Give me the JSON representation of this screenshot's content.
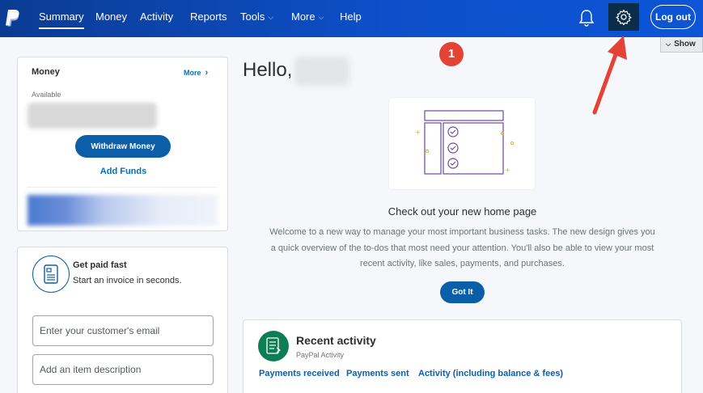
{
  "nav": {
    "items": [
      {
        "label": "Summary"
      },
      {
        "label": "Money"
      },
      {
        "label": "Activity"
      },
      {
        "label": "Reports"
      },
      {
        "label": "Tools"
      },
      {
        "label": "More"
      },
      {
        "label": "Help"
      }
    ],
    "logout_label": "Log out",
    "icons": {
      "logo": "paypal-logo-icon",
      "bell": "bell-icon",
      "gear": "gear-icon"
    },
    "gradient_colors": [
      "#0b3c93",
      "#0d55d6"
    ],
    "settings_highlight_color": "#0a2d4a"
  },
  "show_toggle": {
    "label": "Show"
  },
  "annotation": {
    "step_number": "1",
    "color": "#e34234"
  },
  "money_card": {
    "title": "Money",
    "more_label": "More",
    "available_label": "Available",
    "withdraw_label": "Withdraw Money",
    "add_funds_label": "Add Funds"
  },
  "invoice_card": {
    "title": "Get paid fast",
    "subtitle": "Start an invoice in seconds.",
    "email_placeholder": "Enter your customer's email",
    "item_placeholder": "Add an item description"
  },
  "greeting": {
    "hello": "Hello,"
  },
  "home_promo": {
    "title": "Check out your new home page",
    "description": "Welcome to a new way to manage your most important business tasks. The new design gives you a quick overview of the to-dos that most need your attention. You'll also be able to view your most recent activity, like sales, payments, and purchases.",
    "button_label": "Got It"
  },
  "recent_activity": {
    "title": "Recent activity",
    "subtitle": "PayPal Activity",
    "links": [
      "Payments received",
      "Payments sent",
      "Activity (including balance & fees)"
    ]
  },
  "colors": {
    "primary_button": "#0c5ea9",
    "link": "#0070ba",
    "activity_icon_bg": "#0d7d56"
  }
}
